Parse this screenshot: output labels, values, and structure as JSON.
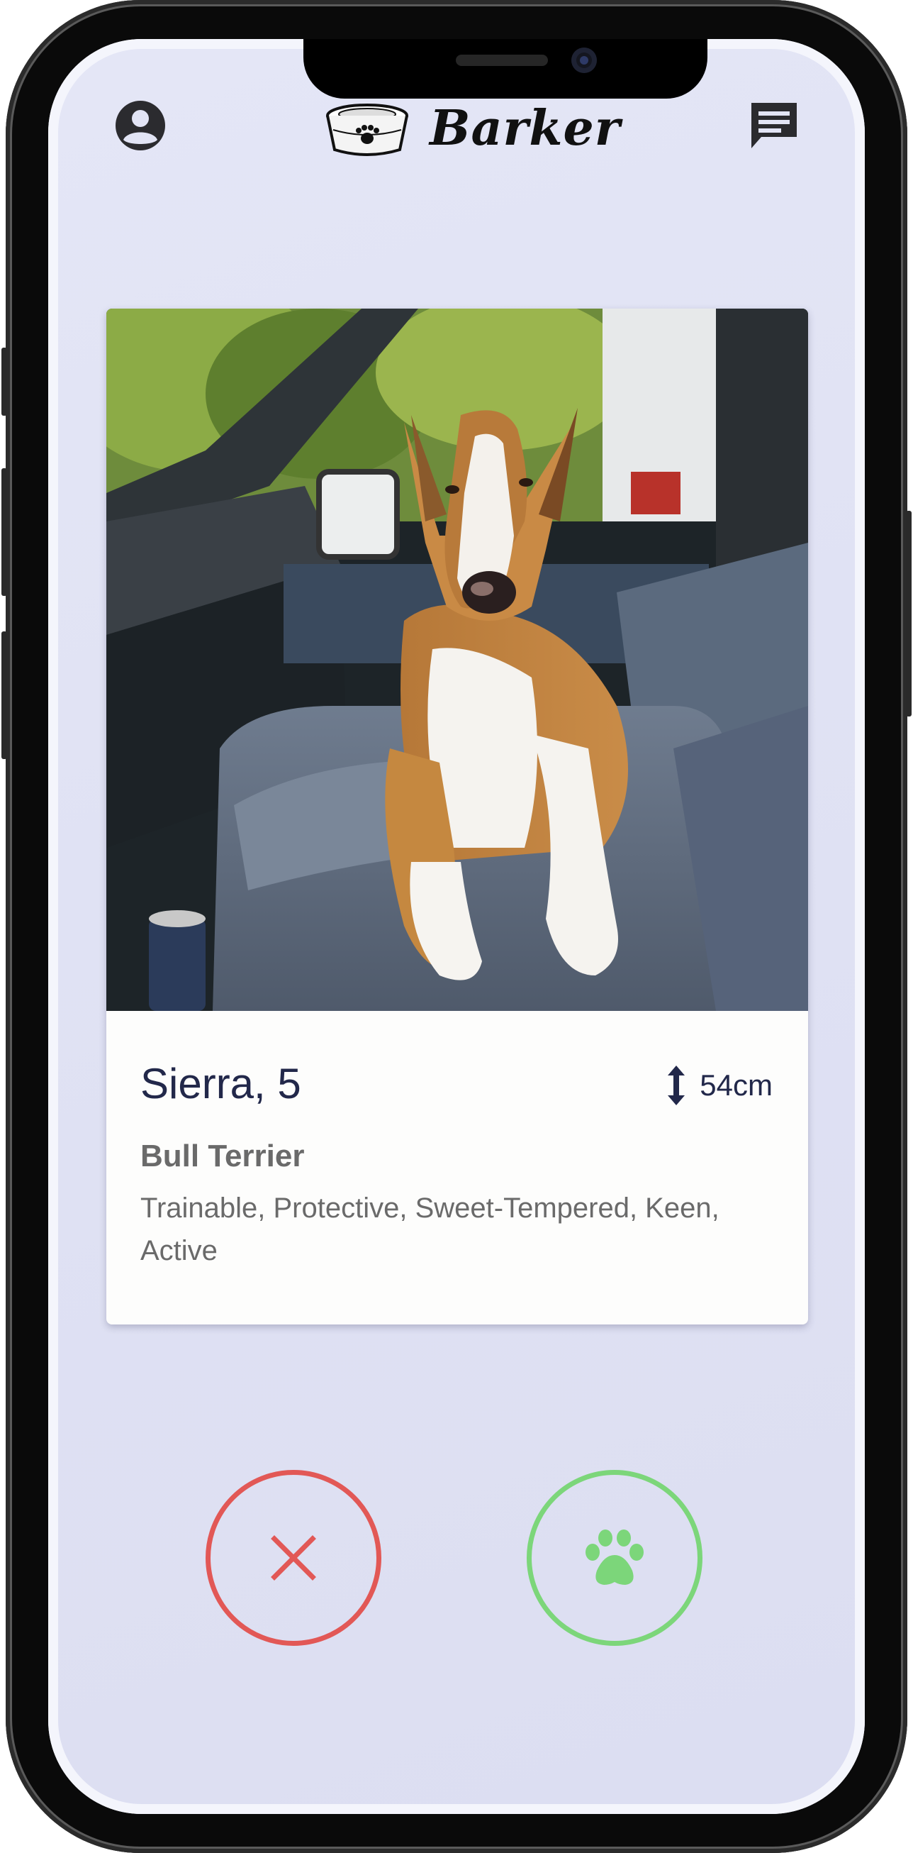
{
  "app": {
    "brand_name": "Barker"
  },
  "header": {
    "profile_icon": "account-circle-icon",
    "messages_icon": "chat-bubble-icon",
    "logo_icon": "dog-bowl-icon"
  },
  "profile_card": {
    "photo": "bull-terrier-in-truck-photo",
    "name_age": "Sierra, 5",
    "height": "54cm",
    "height_icon": "vertical-arrows-icon",
    "breed": "Bull Terrier",
    "traits": "Trainable, Protective, Sweet-Tempered, Keen, Active"
  },
  "actions": {
    "dislike_icon": "close-icon",
    "like_icon": "paw-icon"
  },
  "colors": {
    "background": "#e2e4f5",
    "text_primary": "#22284a",
    "dislike": "#e25856",
    "like": "#7cd67a"
  }
}
